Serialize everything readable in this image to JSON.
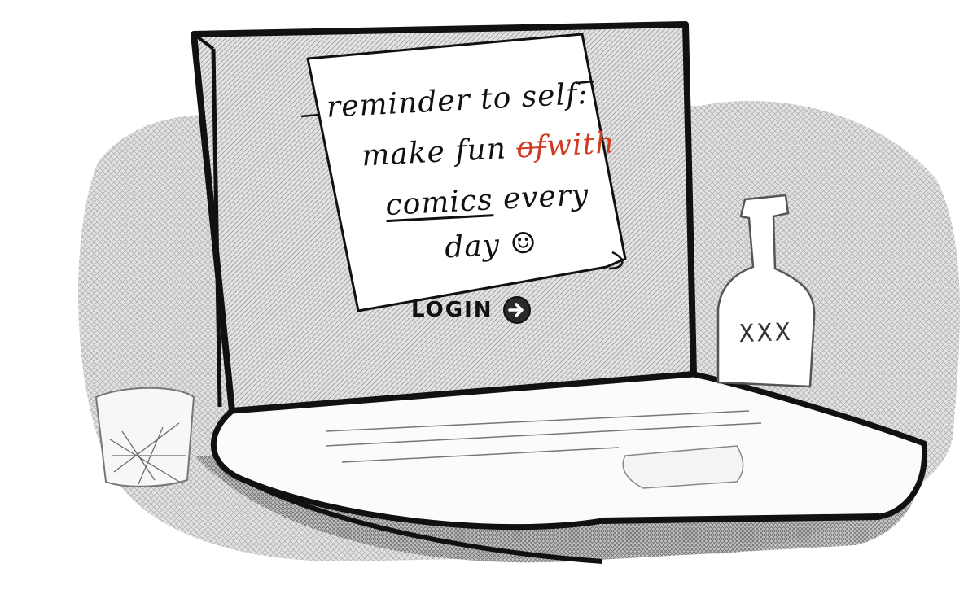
{
  "note": {
    "line1": "reminder to self:",
    "line2_prefix": "make fun ",
    "line2_struck": "of",
    "line2_correction": "with",
    "line3_underlined": "comics",
    "line3_suffix": " every",
    "line4": "day",
    "smiley": "☺"
  },
  "screen": {
    "login_label": "LOGIN",
    "login_icon": "arrow-right-circle-icon"
  },
  "bottle": {
    "label": "XXX"
  },
  "colors": {
    "ink": "#111111",
    "correction_red": "#d23a22",
    "screen_shade": "#bdbdbd",
    "background_shade": "#cfcfcf"
  }
}
